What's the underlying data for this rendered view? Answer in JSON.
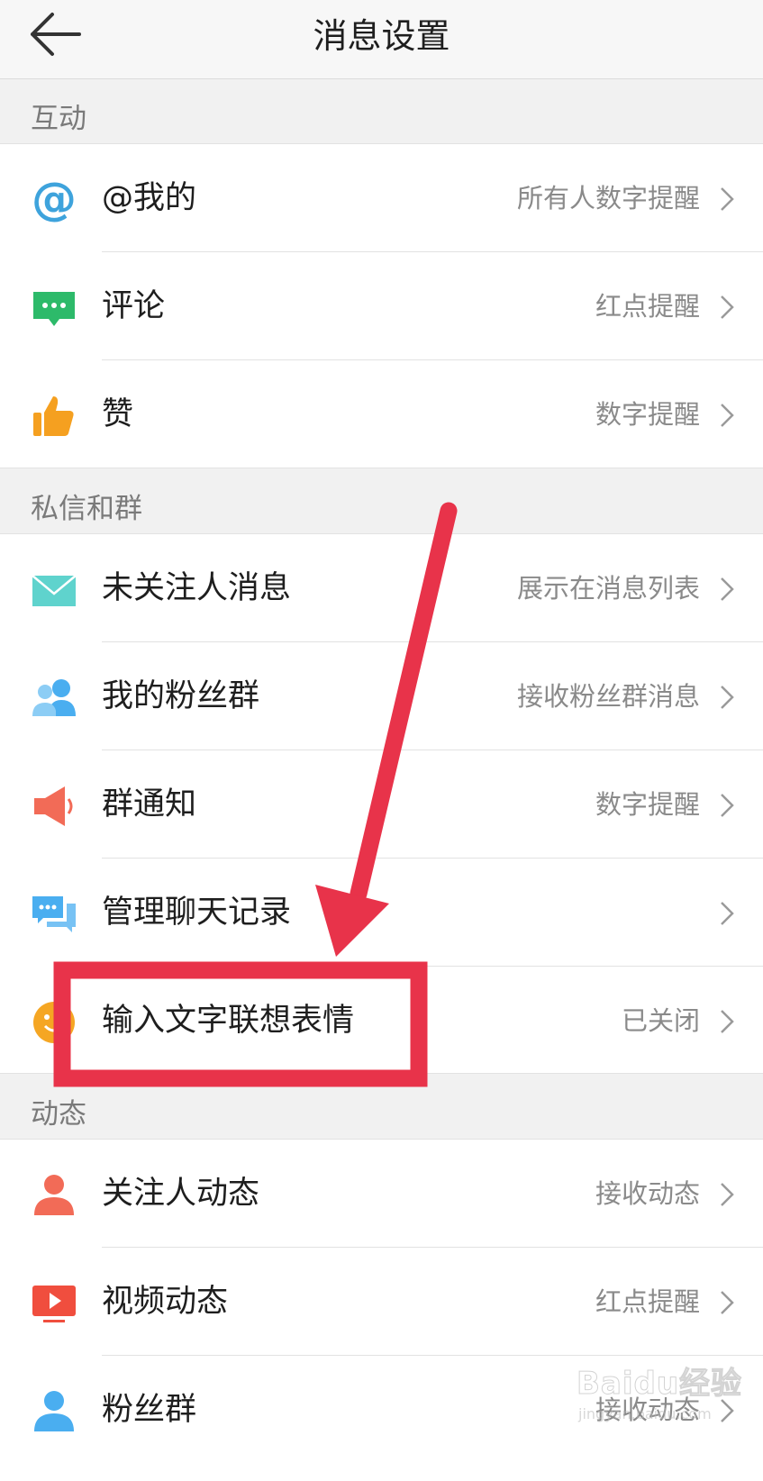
{
  "header": {
    "title": "消息设置"
  },
  "sections": [
    {
      "label": "互动",
      "items": [
        {
          "label": "@我的",
          "value": "所有人数字提醒",
          "icon": "at-icon"
        },
        {
          "label": "评论",
          "value": "红点提醒",
          "icon": "comment-icon"
        },
        {
          "label": "赞",
          "value": "数字提醒",
          "icon": "thumbs-up-icon"
        }
      ]
    },
    {
      "label": "私信和群",
      "items": [
        {
          "label": "未关注人消息",
          "value": "展示在消息列表",
          "icon": "envelope-icon"
        },
        {
          "label": "我的粉丝群",
          "value": "接收粉丝群消息",
          "icon": "fans-group-icon"
        },
        {
          "label": "群通知",
          "value": "数字提醒",
          "icon": "speaker-icon"
        },
        {
          "label": "管理聊天记录",
          "value": "",
          "icon": "chat-bubbles-icon"
        },
        {
          "label": "输入文字联想表情",
          "value": "已关闭",
          "icon": "emoji-icon"
        }
      ]
    },
    {
      "label": "动态",
      "items": [
        {
          "label": "关注人动态",
          "value": "接收动态",
          "icon": "person-icon"
        },
        {
          "label": "视频动态",
          "value": "红点提醒",
          "icon": "video-icon"
        },
        {
          "label": "粉丝群",
          "value": "接收动态",
          "icon": "fans-icon"
        }
      ]
    }
  ],
  "watermark": {
    "logo": "Baidu经验",
    "url": "jingyan.baidu.com"
  },
  "colors": {
    "annotation": "#e8334a",
    "at_icon": "#3ea3dc",
    "comment_icon": "#2dba6a",
    "thumbs_icon": "#f5a020",
    "envelope_icon": "#5fd3cd",
    "fans_icon": "#4aaef0",
    "speaker_icon": "#f26b57",
    "chat_icon": "#4aaef0",
    "emoji_icon": "#f5a623",
    "person_icon": "#f26b57",
    "video_icon": "#f04e3e"
  }
}
